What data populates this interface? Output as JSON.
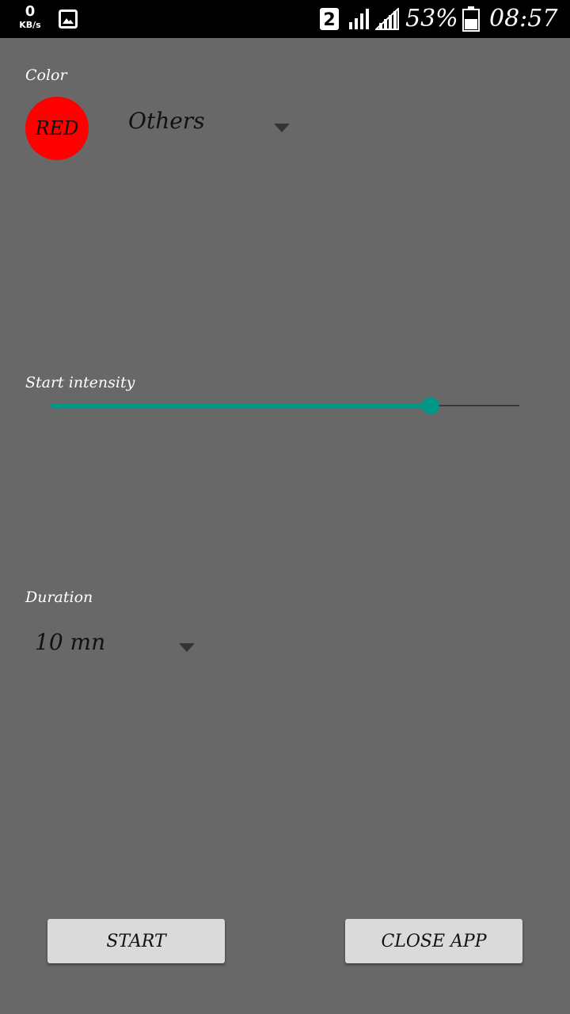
{
  "status_bar": {
    "net_speed_value": "0",
    "net_speed_unit": "KB/s",
    "battery_percent": "53%",
    "time": "08:57",
    "sim_slot": "2",
    "icons": [
      "gallery-icon",
      "sim-2-icon",
      "signal-icon",
      "signal-icon",
      "battery-icon"
    ]
  },
  "color_section": {
    "label": "Color",
    "swatch_text": "RED",
    "swatch_color": "#ff0000",
    "selected_option": "Others"
  },
  "intensity_section": {
    "label": "Start intensity",
    "level_fraction": 0.81,
    "accent_color": "#009688"
  },
  "duration_section": {
    "label": "Duration",
    "selected_option": "10 mn"
  },
  "buttons": {
    "start_label": "START",
    "close_label": "CLOSE APP"
  }
}
